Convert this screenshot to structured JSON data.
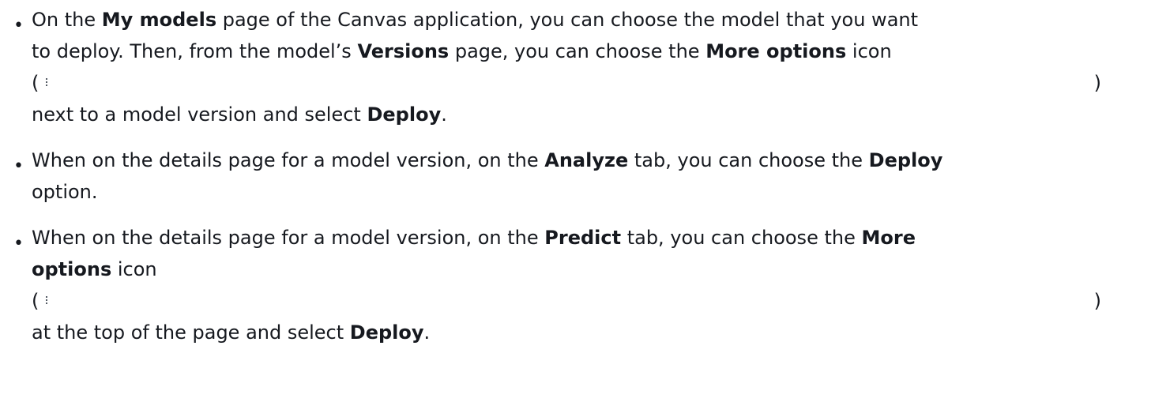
{
  "items": [
    {
      "line1": {
        "t1": "On the ",
        "b1": "My models",
        "t2": " page of the Canvas application, you can choose the model that you want"
      },
      "line2": {
        "t1": "to deploy. Then, from the model’s ",
        "b1": "Versions",
        "t2": " page, you can choose the ",
        "b2": "More options",
        "t3": " icon"
      },
      "icon_open": "(",
      "icon_close": ")",
      "icon_name": "more-options-icon",
      "line3": {
        "t1": "next to a model version and select ",
        "b1": "Deploy",
        "t2": "."
      }
    },
    {
      "line1": {
        "t1": "When on the details page for a model version, on the ",
        "b1": "Analyze",
        "t2": " tab, you can choose the ",
        "b2": "Deploy"
      },
      "line2": {
        "t1": "option."
      }
    },
    {
      "line1": {
        "t1": "When on the details page for a model version, on the ",
        "b1": "Predict",
        "t2": " tab, you can choose the ",
        "b2": "More"
      },
      "line2": {
        "b1": "options",
        "t1": " icon"
      },
      "icon_open": "(",
      "icon_close": ")",
      "icon_name": "more-options-icon",
      "line3": {
        "t1": "at the top of the page and select ",
        "b1": "Deploy",
        "t2": "."
      }
    }
  ],
  "bullet_char": "•"
}
